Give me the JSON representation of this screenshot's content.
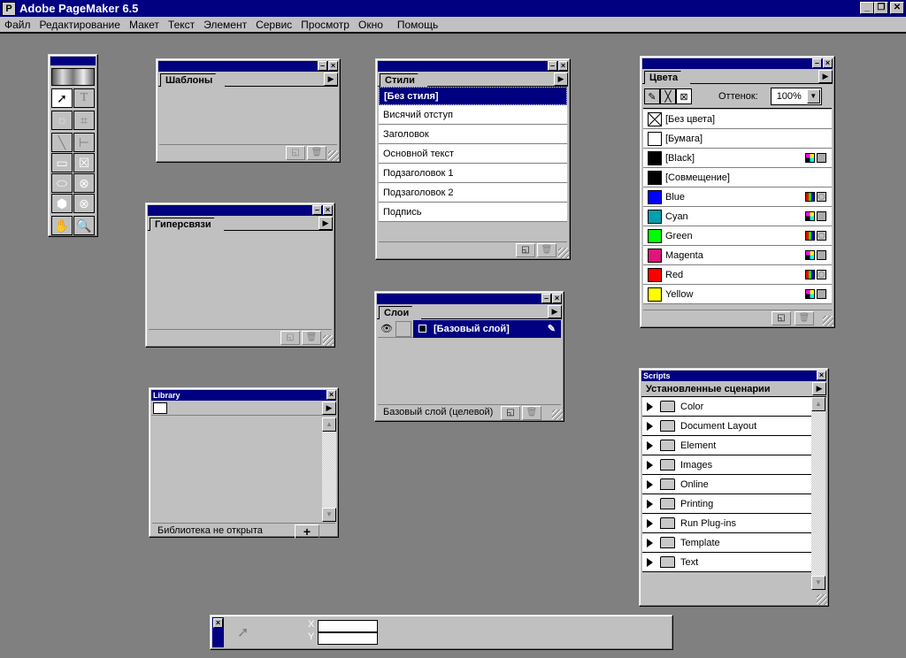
{
  "app": {
    "title": "Adobe PageMaker 6.5",
    "icon": "P"
  },
  "window_buttons": {
    "minimize": "_",
    "restore": "❐",
    "close": "✕"
  },
  "menu": [
    "Файл",
    "Редактирование",
    "Макет",
    "Текст",
    "Элемент",
    "Сервис",
    "Просмотр",
    "Окно",
    "Помощь"
  ],
  "templates": {
    "tab": "Шаблоны"
  },
  "hyperlinks": {
    "tab": "Гиперсвязи"
  },
  "library": {
    "title": "Library",
    "status": "Библиотека не открыта",
    "add": "+"
  },
  "styles": {
    "tab": "Стили",
    "items": [
      "[Без стиля]",
      "Висячий отступ",
      "Заголовок",
      "Основной текст",
      "Подзаголовок 1",
      "Подзаголовок 2",
      "Подпись"
    ]
  },
  "layers": {
    "tab": "Слои",
    "layer": "[Базовый слой]",
    "status": "Базовый слой (целевой)"
  },
  "colors": {
    "tab": "Цвета",
    "tint_label": "Оттенок:",
    "tint_value": "100%",
    "items": [
      {
        "name": "[Без цвета]",
        "hex": "none",
        "mark": ""
      },
      {
        "name": "[Бумага]",
        "hex": "#ffffff",
        "mark": ""
      },
      {
        "name": "[Black]",
        "hex": "#000000",
        "mark": "cmyk"
      },
      {
        "name": "[Совмещение]",
        "hex": "#000000",
        "mark": ""
      },
      {
        "name": "Blue",
        "hex": "#0000ff",
        "mark": "rgb"
      },
      {
        "name": "Cyan",
        "hex": "#00a0b0",
        "mark": "cmyk"
      },
      {
        "name": "Green",
        "hex": "#00ff00",
        "mark": "rgb"
      },
      {
        "name": "Magenta",
        "hex": "#e0157a",
        "mark": "cmyk"
      },
      {
        "name": "Red",
        "hex": "#ff0000",
        "mark": "rgb"
      },
      {
        "name": "Yellow",
        "hex": "#ffff00",
        "mark": "cmyk"
      }
    ]
  },
  "scripts": {
    "title": "Scripts",
    "header": "Установленные сценарии",
    "items": [
      "Color",
      "Document Layout",
      "Element",
      "Images",
      "Online",
      "Printing",
      "Run Plug-ins",
      "Template",
      "Text"
    ]
  },
  "control": {
    "x_label": "X",
    "y_label": "Y",
    "x_value": "",
    "y_value": ""
  }
}
